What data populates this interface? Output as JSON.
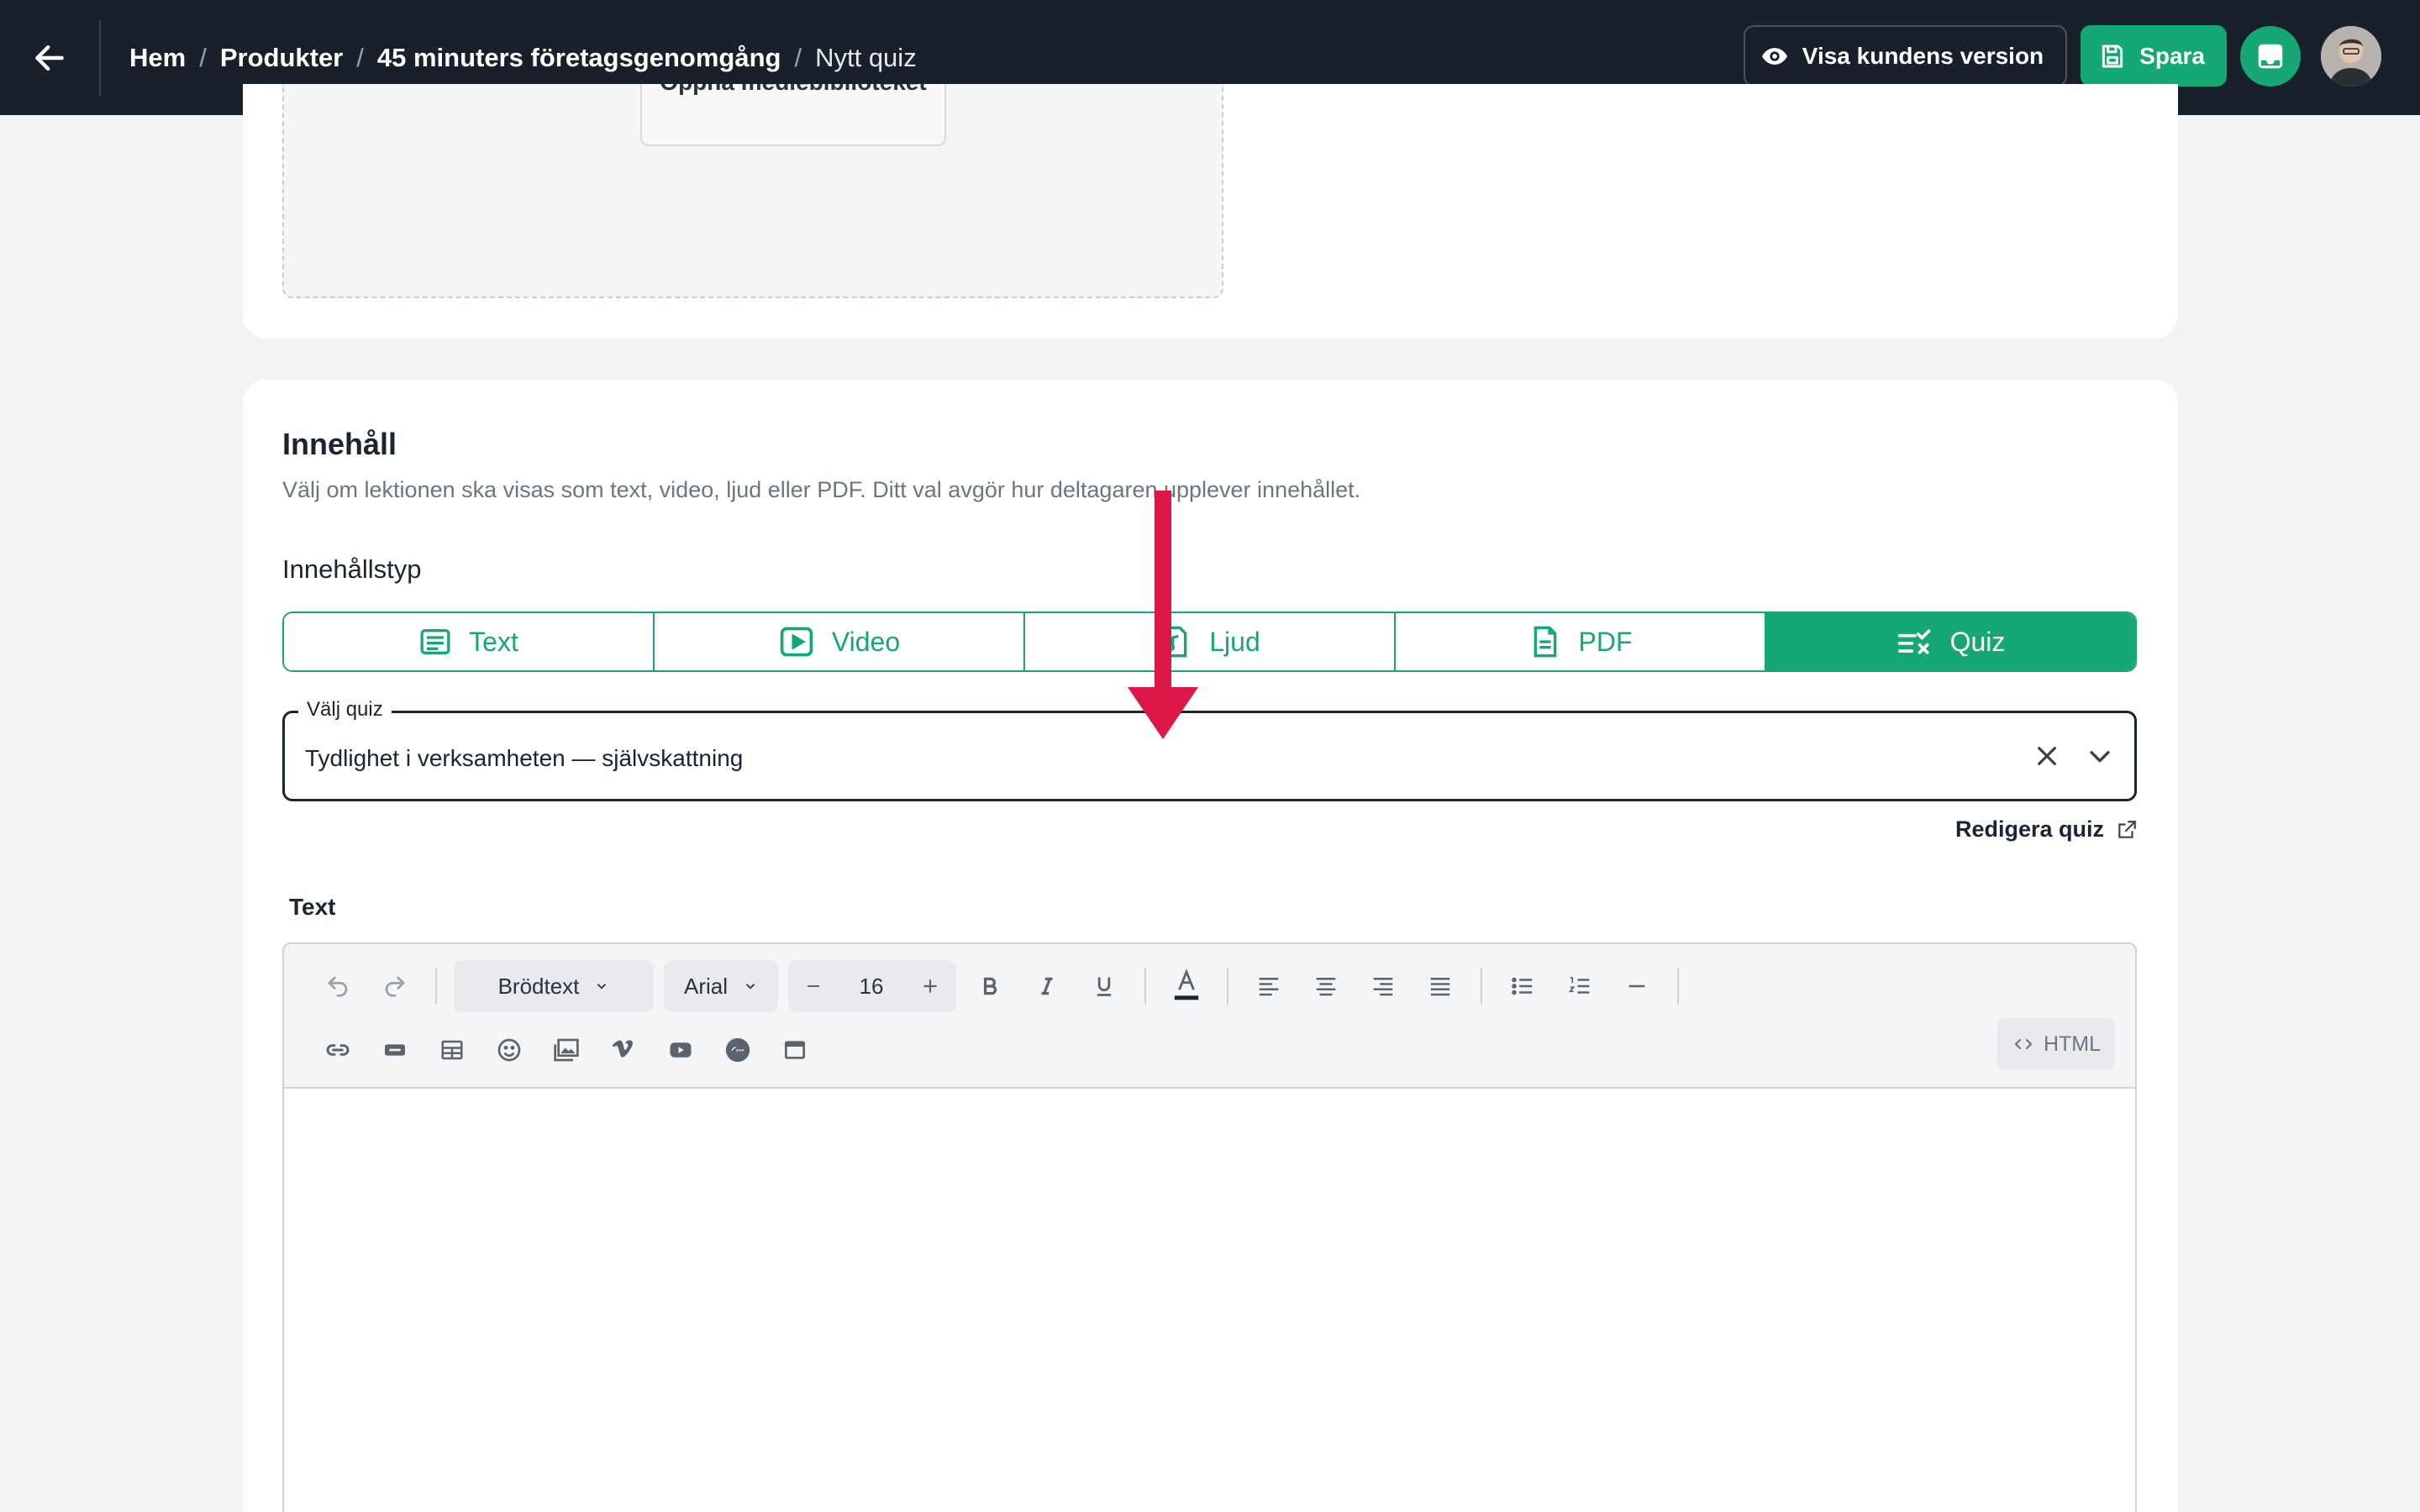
{
  "header": {
    "breadcrumbs": [
      "Hem",
      "Produkter",
      "45 minuters företagsgenomgång",
      "Nytt quiz"
    ],
    "separator": "/",
    "preview_label": "Visa kundens version",
    "save_label": "Spara"
  },
  "media": {
    "open_library_label": "Öppna mediebiblioteket"
  },
  "content": {
    "title": "Innehåll",
    "description": "Välj om lektionen ska visas som text, video, ljud eller PDF. Ditt val avgör hur deltagaren upplever innehållet.",
    "type_label": "Innehållstyp",
    "types": [
      {
        "label": "Text",
        "icon": "text-lines-icon",
        "active": false
      },
      {
        "label": "Video",
        "icon": "play-icon",
        "active": false
      },
      {
        "label": "Ljud",
        "icon": "audio-file-icon",
        "active": false
      },
      {
        "label": "PDF",
        "icon": "document-icon",
        "active": false
      },
      {
        "label": "Quiz",
        "icon": "quiz-check-icon",
        "active": true
      }
    ],
    "quiz_select": {
      "legend": "Välj quiz",
      "value": "Tydlighet i verksamheten — självskattning"
    },
    "edit_quiz_label": "Redigera quiz",
    "text_label": "Text"
  },
  "editor": {
    "paragraph_style": "Brödtext",
    "font": "Arial",
    "font_size": "16",
    "html_label": "HTML"
  },
  "colors": {
    "accent": "#16a874",
    "topbar": "#18212b",
    "annotation_arrow": "#dd1747"
  }
}
